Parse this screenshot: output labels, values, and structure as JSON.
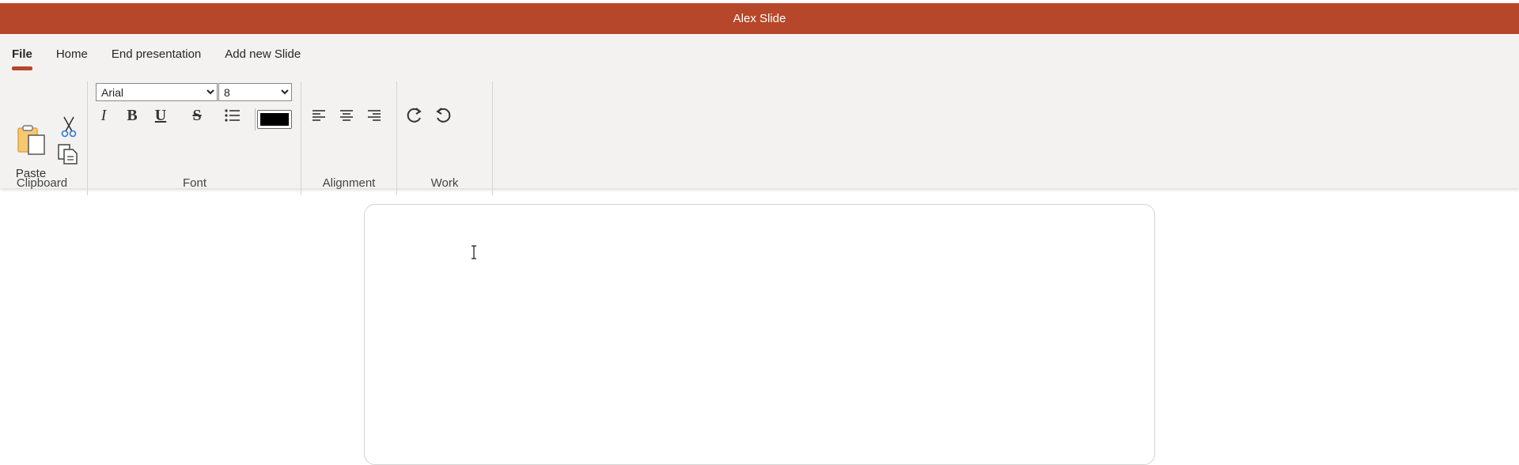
{
  "app": {
    "title": "Alex Slide"
  },
  "tabs": [
    {
      "label": "File",
      "active": true
    },
    {
      "label": "Home",
      "active": false
    },
    {
      "label": "End presentation",
      "active": false
    },
    {
      "label": "Add new Slide",
      "active": false
    }
  ],
  "clipboard": {
    "group_label": "Clipboard",
    "paste_label": "Paste"
  },
  "font": {
    "group_label": "Font",
    "family_value": "Arial",
    "family_options": [
      "Arial"
    ],
    "size_value": "8",
    "size_options": [
      "8"
    ],
    "text_color": "#000000"
  },
  "alignment": {
    "group_label": "Alignment"
  },
  "work": {
    "group_label": "Work"
  },
  "colors": {
    "accent": "#b7472a",
    "ribbon_bg": "#f3f2f1"
  }
}
